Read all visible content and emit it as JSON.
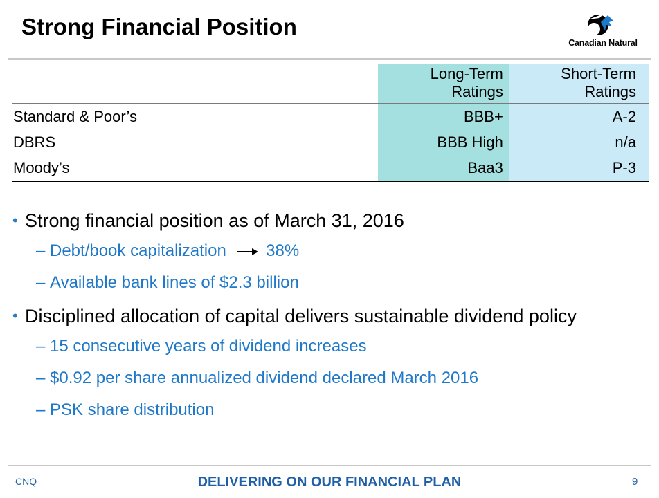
{
  "slide": {
    "title": "Strong Financial Position",
    "logo_text": "Canadian Natural"
  },
  "ratings_table": {
    "headers": {
      "long_term": [
        "Long-Term",
        "Ratings"
      ],
      "short_term": [
        "Short-Term",
        "Ratings"
      ]
    },
    "rows": [
      {
        "agency": "Standard & Poor’s",
        "long_term": "BBB+",
        "short_term": "A-2"
      },
      {
        "agency": "DBRS",
        "long_term": "BBB High",
        "short_term": "n/a"
      },
      {
        "agency": "Moody’s",
        "long_term": "Baa3",
        "short_term": "P-3"
      }
    ]
  },
  "bullets": [
    {
      "text": "Strong financial position as of March 31, 2016",
      "sub": [
        {
          "text": "Debt/book capitalization",
          "arrow_value": "38%"
        },
        {
          "text": "Available bank lines of $2.3 billion"
        }
      ]
    },
    {
      "text": "Disciplined allocation of capital delivers sustainable dividend policy",
      "sub": [
        {
          "text": "15 consecutive years of dividend increases"
        },
        {
          "text": "$0.92 per share annualized dividend declared March 2016"
        },
        {
          "text": "PSK share distribution"
        }
      ]
    }
  ],
  "footer": {
    "left": "CNQ",
    "center": "DELIVERING ON OUR FINANCIAL PLAN",
    "page_number": "9"
  },
  "colors": {
    "accent_blue": "#1f78c8",
    "long_term_fill": "#a5e0e0",
    "short_term_fill": "#cbeaf8"
  }
}
